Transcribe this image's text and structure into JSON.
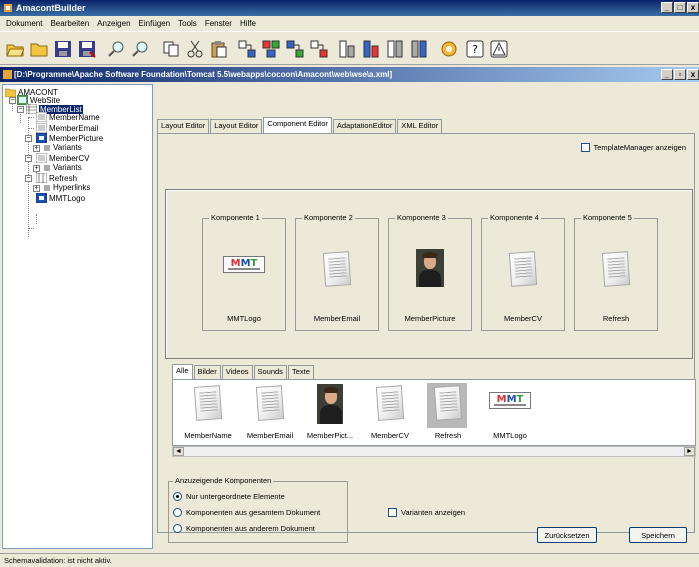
{
  "window": {
    "title": "AmacontBuilder",
    "min": "_",
    "max": "□",
    "close": "x"
  },
  "menu": [
    "Dokument",
    "Bearbeiten",
    "Anzeigen",
    "Einfügen",
    "Tools",
    "Fenster",
    "Hilfe"
  ],
  "toolbar_icons": [
    "open-folder-icon",
    "new-folder-icon",
    "save-icon",
    "save-as-icon",
    "zoom-in-icon",
    "zoom-out-icon",
    "copy-icon",
    "cut-icon",
    "paste-icon",
    "component-1-icon",
    "component-2-icon",
    "component-3-icon",
    "component-4-icon",
    "component-5-icon",
    "component-6-icon",
    "component-7-icon",
    "component-8-icon",
    "settings-icon",
    "help-icon",
    "warning-icon"
  ],
  "document": {
    "path": "[D:\\Programme\\Apache Software Foundation\\Tomcat 5.5\\webapps\\cocoon\\Amacont\\web\\wse\\a.xml]",
    "min": "_",
    "max": "▫",
    "close": "x"
  },
  "tree": {
    "root": "AMACONT",
    "website": "WebSite",
    "memberlist": "MemberList",
    "membername": "MemberName",
    "memberemail": "MemberEmail",
    "memberpicture": "MemberPicture",
    "variants1": "Variants",
    "membercv": "MemberCV",
    "variants2": "Variants",
    "refresh": "Refresh",
    "hyperlinks": "Hyperlinks",
    "mmtlogo": "MMTLogo"
  },
  "tabs": [
    "Layout Editor",
    "Layout Editor",
    "Component Editor",
    "AdaptationEditor",
    "XML Editor"
  ],
  "template_manager": {
    "label": "TemplateManager anzeigen",
    "checked": false
  },
  "components": [
    {
      "legend": "Komponente 1",
      "label": "MMTLogo",
      "kind": "logo"
    },
    {
      "legend": "Komponente 2",
      "label": "MemberEmail",
      "kind": "doc"
    },
    {
      "legend": "Komponente 3",
      "label": "MemberPicture",
      "kind": "photo"
    },
    {
      "legend": "Komponente 4",
      "label": "MemberCV",
      "kind": "doc"
    },
    {
      "legend": "Komponente 5",
      "label": "Refresh",
      "kind": "doc"
    }
  ],
  "mmt_logo_text": "MMT",
  "library_tabs": [
    "Alle",
    "Bilder",
    "Videos",
    "Sounds",
    "Texte"
  ],
  "library_items": [
    {
      "label": "MemberName",
      "kind": "doc"
    },
    {
      "label": "MemberEmail",
      "kind": "doc"
    },
    {
      "label": "MemberPict...",
      "kind": "photo"
    },
    {
      "label": "MemberCV",
      "kind": "doc"
    },
    {
      "label": "Refresh",
      "kind": "doc",
      "selected": true
    },
    {
      "label": "MMTLogo",
      "kind": "logo"
    }
  ],
  "scroll": {
    "left": "◄",
    "right": "►"
  },
  "filter": {
    "legend": "Anzuzeigende Komponenten",
    "options": [
      "Nur untergeordnete Elemente",
      "Komponenten aus gesamtem Dokument",
      "Komponenten aus anderem Dokument"
    ],
    "selected_index": 0
  },
  "variants_checkbox": {
    "label": "Varianten anzeigen",
    "checked": false
  },
  "buttons": {
    "reset": "Zurücksetzen",
    "save": "Speichern"
  },
  "status": "Schemavalidation: ist nicht aktiv.",
  "colors": {
    "title_bar": "#0a246a",
    "selection": "#0a246a",
    "background": "#ece9d8"
  }
}
